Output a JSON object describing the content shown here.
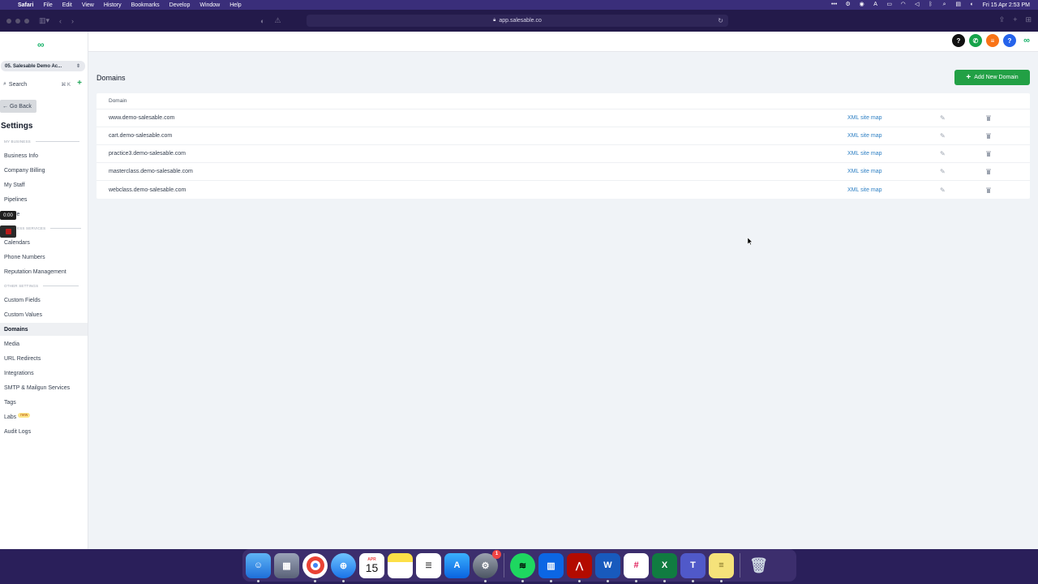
{
  "menubar": {
    "app": "Safari",
    "items": [
      "File",
      "Edit",
      "View",
      "History",
      "Bookmarks",
      "Develop",
      "Window",
      "Help"
    ],
    "datetime": "Fri 15 Apr  2:53 PM"
  },
  "browser": {
    "url": "app.salesable.co"
  },
  "sidebar": {
    "account": "05. Salesable Demo Ac...",
    "search_placeholder": "Search",
    "search_shortcut": "⌘ K",
    "go_back": "Go Back",
    "title": "Settings",
    "sections": {
      "my_business": "MY BUSINESS",
      "business_services": "ESS SERVICES",
      "other_settings": "OTHER SETTINGS"
    },
    "items": {
      "business_info": "Business Info",
      "company_billing": "Company Billing",
      "my_staff": "My Staff",
      "pipelines": "Pipelines",
      "partial": "le",
      "calendars": "Calendars",
      "phone_numbers": "Phone Numbers",
      "reputation": "Reputation Management",
      "custom_fields": "Custom Fields",
      "custom_values": "Custom Values",
      "domains": "Domains",
      "media": "Media",
      "url_redirects": "URL Redirects",
      "integrations": "Integrations",
      "smtp": "SMTP & Mailgun Services",
      "tags": "Tags",
      "labs": "Labs",
      "labs_badge": "new",
      "audit_logs": "Audit Logs"
    }
  },
  "recording": {
    "timer": "0:00"
  },
  "topbar": {
    "icons": [
      "help-black",
      "phone",
      "list",
      "help-blue",
      "logo"
    ]
  },
  "main": {
    "title": "Domains",
    "add_button": "Add New Domain",
    "table": {
      "header": "Domain",
      "rows": [
        {
          "domain": "www.demo-salesable.com",
          "link": "XML site map"
        },
        {
          "domain": "cart.demo-salesable.com",
          "link": "XML site map"
        },
        {
          "domain": "practice3.demo-salesable.com",
          "link": "XML site map"
        },
        {
          "domain": "masterclass.demo-salesable.com",
          "link": "XML site map"
        },
        {
          "domain": "webclass.demo-salesable.com",
          "link": "XML site map"
        }
      ]
    }
  },
  "dock": {
    "calendar_month": "APR",
    "calendar_day": "15",
    "settings_badge": "1"
  },
  "colors": {
    "accent_green": "#22a045",
    "link_blue": "#2f80c4",
    "menubar_bg": "#3a2e7a"
  }
}
